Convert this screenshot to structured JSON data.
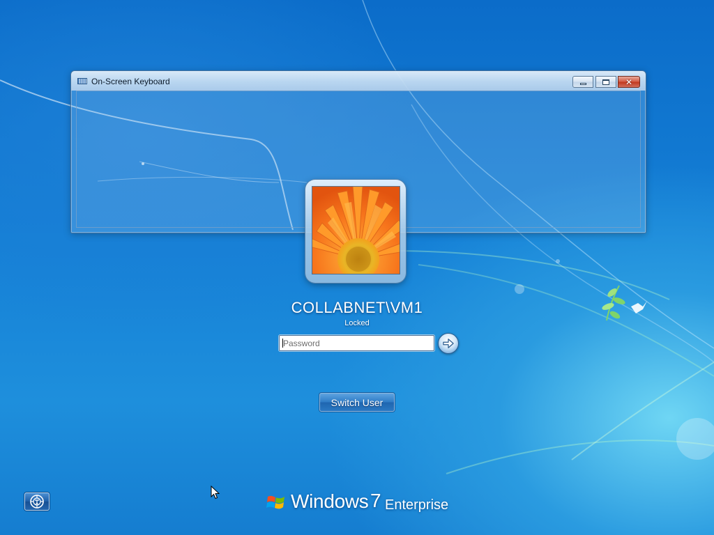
{
  "osk_window": {
    "title": "On-Screen Keyboard",
    "icon": "keyboard-icon",
    "controls": {
      "minimize_icon": "minimize-icon",
      "maximize_icon": "maximize-icon",
      "close_icon": "close-icon",
      "close_glyph": "✕"
    }
  },
  "logon": {
    "user_picture_icon": "orange-flower-picture",
    "username": "COLLABNET\\VM1",
    "status": "Locked",
    "password_placeholder": "Password",
    "password_value": "",
    "submit_icon": "arrow-right-icon",
    "switch_user_label": "Switch User"
  },
  "ease_of_access": {
    "icon": "ease-of-access-icon"
  },
  "branding": {
    "logo_icon": "windows-flag-logo",
    "name": "Windows",
    "version": "7",
    "edition": "Enterprise"
  },
  "colors": {
    "background_top": "#0b6cc9",
    "background_glow": "#6fd6f4",
    "close_button": "#c23a20",
    "switch_user_button": "#2f7cc6"
  }
}
